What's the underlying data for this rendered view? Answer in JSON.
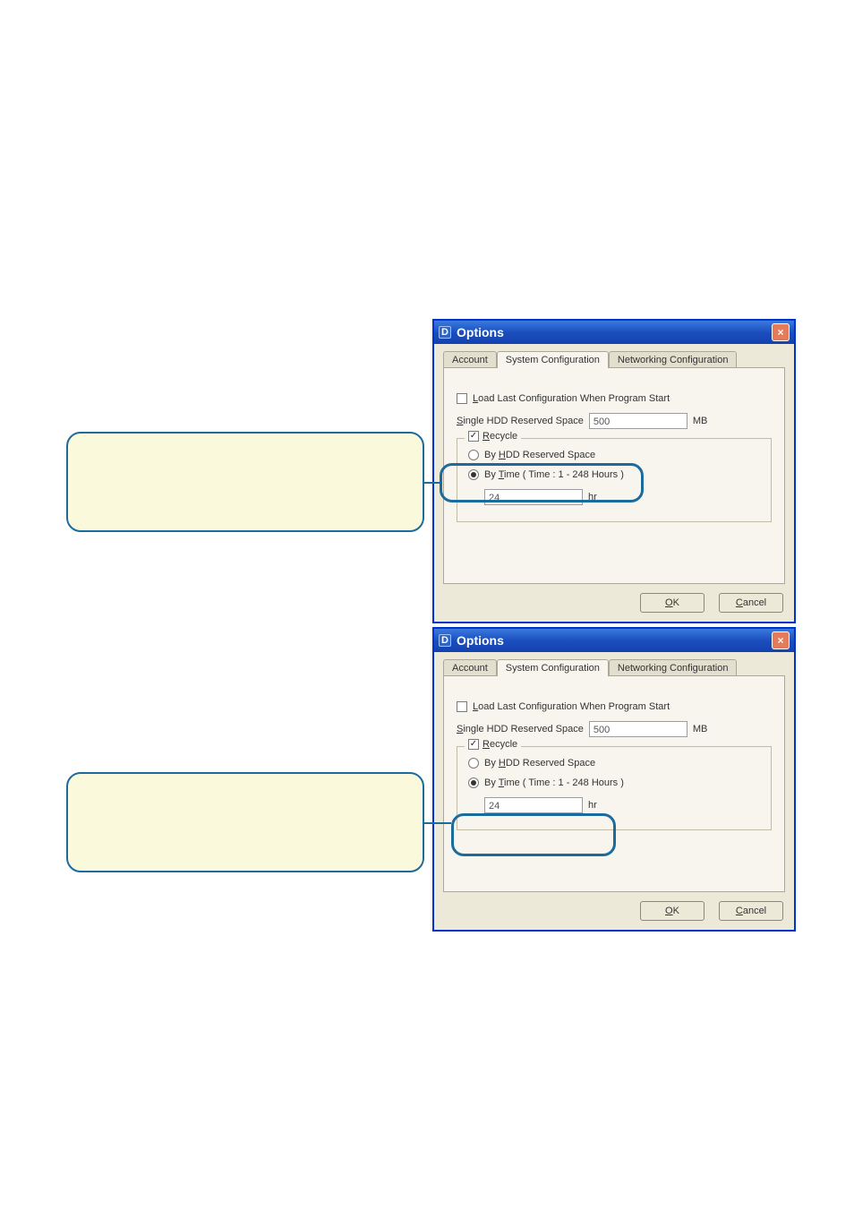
{
  "dialog": {
    "icon_letter": "D",
    "title": "Options",
    "close_glyph": "×",
    "tabs": {
      "account": "Account",
      "sysconf": "System Configuration",
      "netconf": "Networking Configuration"
    },
    "labels": {
      "load_last": "Load Last Configuration When Program Start",
      "hdd_reserved": "Single HDD Reserved Space",
      "hdd_unit": "MB",
      "recycle": "Recycle",
      "by_hdd": "By HDD Reserved Space",
      "by_time": "By Time ( Time : 1 - 248 Hours )",
      "hr_unit": "hr",
      "ok": "OK",
      "cancel": "Cancel"
    },
    "values": {
      "hdd_value": "500",
      "time_value": "24"
    }
  }
}
